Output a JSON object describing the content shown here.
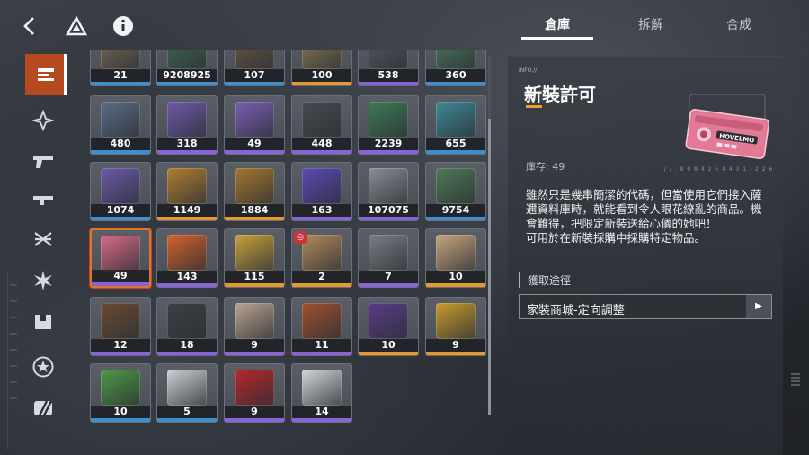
{
  "tabs": [
    "倉庫",
    "拆解",
    "合成"
  ],
  "active_tab": 0,
  "sidebar": {
    "items": [
      {
        "name": "sidebar-item-all",
        "icon": "list-stack-icon",
        "active": true
      },
      {
        "name": "sidebar-item-doll",
        "icon": "star-compass-icon",
        "active": false
      },
      {
        "name": "sidebar-item-weapon",
        "icon": "pistol-icon",
        "active": false
      },
      {
        "name": "sidebar-item-attachment",
        "icon": "rifle-part-icon",
        "active": false
      },
      {
        "name": "sidebar-item-materials",
        "icon": "crossed-arrows-icon",
        "active": false
      },
      {
        "name": "sidebar-item-special",
        "icon": "burst-icon",
        "active": false
      },
      {
        "name": "sidebar-item-supply",
        "icon": "box-icon",
        "active": false
      },
      {
        "name": "sidebar-item-badge",
        "icon": "circle-star-icon",
        "active": false
      },
      {
        "name": "sidebar-item-misc",
        "icon": "slash-square-icon",
        "active": false
      }
    ]
  },
  "grid": {
    "items": [
      {
        "qty": "21",
        "color": "#7a6a55",
        "rarity": "#3d8fd0"
      },
      {
        "qty": "9208925",
        "color": "#3f6b54",
        "rarity": "#3d8fd0"
      },
      {
        "qty": "107",
        "color": "#6a5843",
        "rarity": "#3d8fd0"
      },
      {
        "qty": "100",
        "color": "#8c7a52",
        "rarity": "#e39a2a"
      },
      {
        "qty": "538",
        "color": "#55595f",
        "rarity": "#8b63d8"
      },
      {
        "qty": "360",
        "color": "#4a7a5d",
        "rarity": "#3d8fd0"
      },
      {
        "qty": "480",
        "color": "#5c6c88",
        "rarity": "#3d8fd0"
      },
      {
        "qty": "318",
        "color": "#6e5aa8",
        "rarity": "#8b63d8"
      },
      {
        "qty": "49",
        "color": "#7b5fb4",
        "rarity": "#8b63d8"
      },
      {
        "qty": "448",
        "color": "#474a50",
        "rarity": "#8b63d8"
      },
      {
        "qty": "2239",
        "color": "#3d7b55",
        "rarity": "#8b63d8"
      },
      {
        "qty": "655",
        "color": "#3d8a96",
        "rarity": "#3d8fd0"
      },
      {
        "qty": "1074",
        "color": "#6a5aa8",
        "rarity": "#3d8fd0"
      },
      {
        "qty": "1149",
        "color": "#b07e30",
        "rarity": "#e39a2a"
      },
      {
        "qty": "1884",
        "color": "#a5782e",
        "rarity": "#e39a2a"
      },
      {
        "qty": "163",
        "color": "#5b49b4",
        "rarity": "#8b63d8"
      },
      {
        "qty": "107075",
        "color": "#8a8e94",
        "rarity": "#8b63d8"
      },
      {
        "qty": "9754",
        "color": "#4d7a56",
        "rarity": "#3d8fd0"
      },
      {
        "qty": "49",
        "color": "#d86a86",
        "rarity": "#8b63d8",
        "selected": true
      },
      {
        "qty": "143",
        "color": "#d4622a",
        "rarity": "#8b63d8"
      },
      {
        "qty": "115",
        "color": "#c9a23a",
        "rarity": "#e39a2a"
      },
      {
        "qty": "2",
        "color": "#b58a5a",
        "rarity": "#e39a2a",
        "badge": "◎"
      },
      {
        "qty": "7",
        "color": "#7a7e84",
        "rarity": "#8b63d8"
      },
      {
        "qty": "10",
        "color": "#c8a67e",
        "rarity": "#e39a2a"
      },
      {
        "qty": "12",
        "color": "#6b4a34",
        "rarity": "#8b63d8"
      },
      {
        "qty": "18",
        "color": "#3c3f44",
        "rarity": "#8b63d8"
      },
      {
        "qty": "9",
        "color": "#b9a590",
        "rarity": "#8b63d8"
      },
      {
        "qty": "11",
        "color": "#a0502e",
        "rarity": "#8b63d8"
      },
      {
        "qty": "10",
        "color": "#5a3b88",
        "rarity": "#e39a2a"
      },
      {
        "qty": "9",
        "color": "#c99b2c",
        "rarity": "#e39a2a"
      },
      {
        "qty": "10",
        "color": "#4e9a48",
        "rarity": "#3d8fd0"
      },
      {
        "qty": "5",
        "color": "#cdd0d4",
        "rarity": "#3d8fd0"
      },
      {
        "qty": "9",
        "color": "#b8262c",
        "rarity": "#8b63d8"
      },
      {
        "qty": "14",
        "color": "#d4d6d9",
        "rarity": "#8b63d8"
      }
    ]
  },
  "detail": {
    "info_tag": "INFO.//",
    "title": "新裝許可",
    "art_brand": "HOVELMO",
    "art_code": "/ / . 8 0 8 4 2 5       4 4 3 1 - 2 2 6",
    "stock_label": "庫存: 49",
    "description": "雖然只是幾串簡潔的代碼，但當使用它們接入薩邇資料庫時，就能看到令人眼花繚亂的商品。機會難得，把限定新裝送給心儀的她吧！\n可用於在新裝採購中採購特定物品。",
    "section_label": "獲取途徑",
    "source_text": "家裝商城-定向調整",
    "source_button": "▶"
  },
  "colors": {
    "accent": "#b5491f",
    "selected_border": "#e0752b",
    "underline": "#f0a020"
  }
}
